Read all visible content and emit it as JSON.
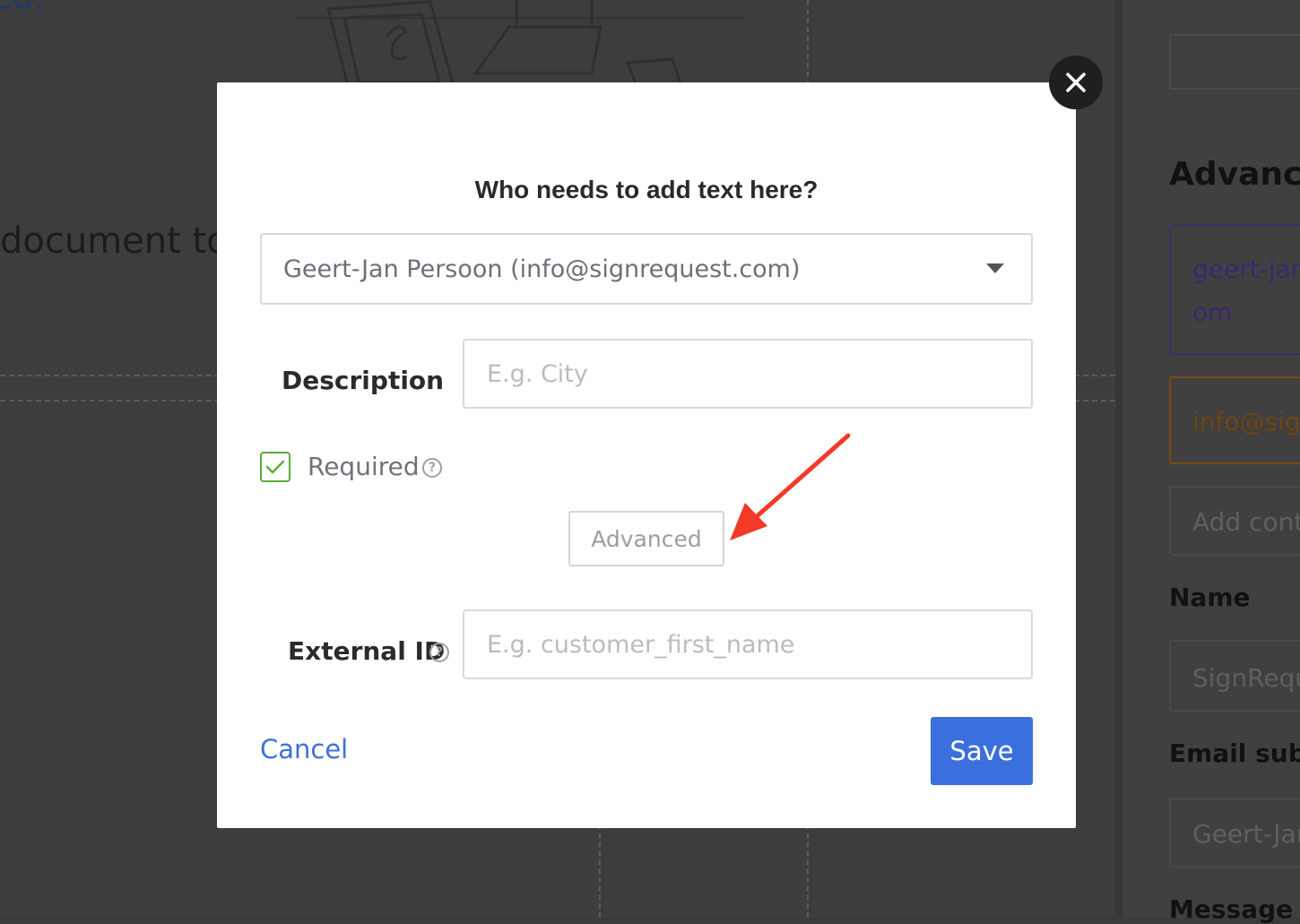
{
  "background": {
    "heading_fragment": "ed.",
    "document_text": "document to",
    "side_heading": "Advance",
    "signer_email_1": "geert-jan",
    "signer_email_1_cont": "om",
    "signer_email_2": "info@sign",
    "add_contact_placeholder": "Add conta",
    "name_label": "Name",
    "name_value": "SignRequ",
    "email_subject_label": "Email subje",
    "email_subject_value": "Geert-Jan",
    "message_label": "Message"
  },
  "modal": {
    "title": "Who needs to add text here?",
    "signer_select": "Geert-Jan Persoon (info@signrequest.com)",
    "description_label": "Description",
    "description_placeholder": "E.g. City",
    "required_label": "Required",
    "required_checked": true,
    "help_glyph": "?",
    "advanced_label": "Advanced",
    "external_id_label": "External ID",
    "external_id_placeholder": "E.g. customer_first_name",
    "cancel_label": "Cancel",
    "save_label": "Save"
  },
  "colors": {
    "accent_blue": "#3b6fde",
    "link_blue": "#3b73d6",
    "check_green": "#5aab3a",
    "annotation_red": "#f23a26"
  },
  "icons": [
    "close-icon",
    "dropdown-caret-icon",
    "check-icon",
    "help-icon",
    "annotation-arrow-icon"
  ]
}
